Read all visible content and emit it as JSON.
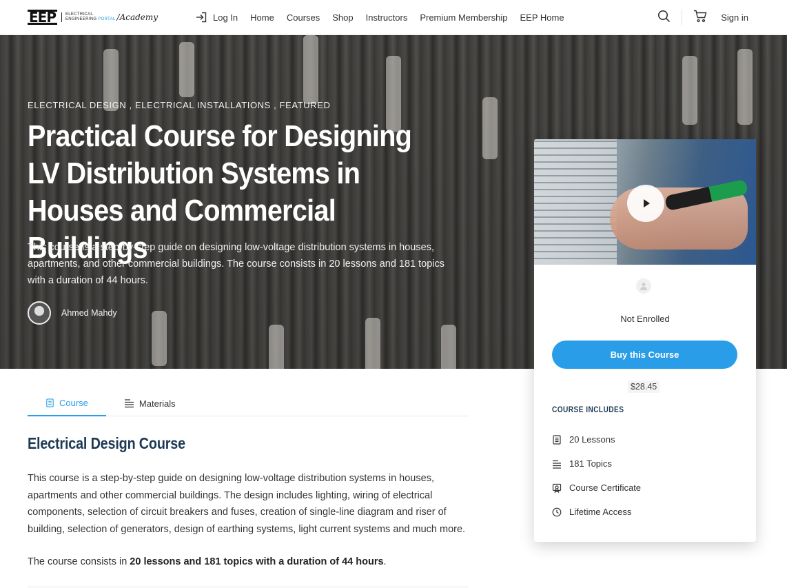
{
  "brand": {
    "logo_mark": "EEP",
    "logo_line1": "ELECTRICAL",
    "logo_line2": "ENGINEERING",
    "logo_portal": "PORTAL",
    "logo_academy": "/Academy"
  },
  "nav": {
    "login": "Log In",
    "items": [
      "Home",
      "Courses",
      "Shop",
      "Instructors",
      "Premium Membership",
      "EEP Home"
    ],
    "signin": "Sign in"
  },
  "hero": {
    "categories": "ELECTRICAL DESIGN ,  ELECTRICAL INSTALLATIONS ,  FEATURED",
    "title": "Practical Course for Designing LV Distribution Systems in Houses and Commercial Buildings",
    "description": "This course is a step-by-step guide on designing low-voltage distribution systems in houses, apartments, and other commercial buildings. The course consists in 20 lessons and 181 topics with a duration of 44 hours.",
    "author": "Ahmed Mahdy"
  },
  "card": {
    "status": "Not Enrolled",
    "buy_label": "Buy this Course",
    "price": "$28.45",
    "includes_title": "COURSE INCLUDES",
    "includes": [
      "20 Lessons",
      "181 Topics",
      "Course Certificate",
      "Lifetime Access"
    ]
  },
  "tabs": {
    "course": "Course",
    "materials": "Materials"
  },
  "content": {
    "section_title": "Electrical Design Course",
    "paragraph1": "This course is a step-by-step guide on designing low-voltage distribution systems in houses, apartments and other commercial buildings. The design includes lighting, wiring of electrical components, selection of circuit breakers and fuses, creation of single-line diagram and riser of building, selection of generators, design of earthing systems, light current systems and much more.",
    "paragraph2_prefix": "The course consists in ",
    "paragraph2_bold": "20 lessons and 181 topics with a duration of 44 hours",
    "paragraph2_suffix": "."
  },
  "colors": {
    "accent": "#2a9de8",
    "heading": "#1d3a55"
  },
  "icons": {
    "search": "search-icon",
    "cart": "cart-icon",
    "login": "login-arrow-icon",
    "play": "play-icon",
    "user": "user-icon",
    "lessons": "document-icon",
    "topics": "list-icon",
    "certificate": "certificate-icon",
    "access": "clock-icon"
  }
}
